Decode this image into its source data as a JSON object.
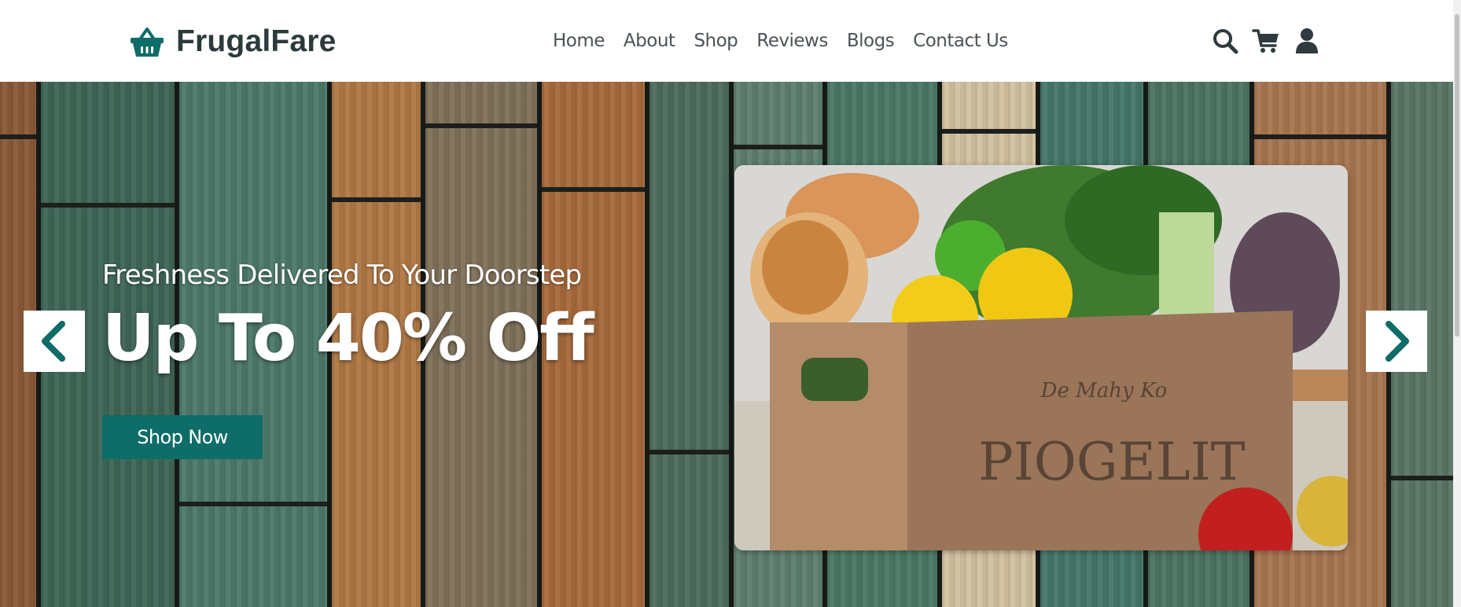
{
  "brand": {
    "name": "FrugalFare",
    "logo_icon": "basket-icon",
    "accent_color": "#0e6d68"
  },
  "nav": {
    "items": [
      {
        "label": "Home"
      },
      {
        "label": "About"
      },
      {
        "label": "Shop"
      },
      {
        "label": "Reviews"
      },
      {
        "label": "Blogs"
      },
      {
        "label": "Contact Us"
      }
    ]
  },
  "header_icons": [
    "search-icon",
    "cart-icon",
    "user-icon"
  ],
  "hero": {
    "subtitle": "Freshness Delivered To Your Doorstep",
    "title": "Up To 40% Off",
    "cta_label": "Shop Now",
    "prev_icon": "chevron-left-icon",
    "next_icon": "chevron-right-icon",
    "image": "grocery-box-image"
  }
}
